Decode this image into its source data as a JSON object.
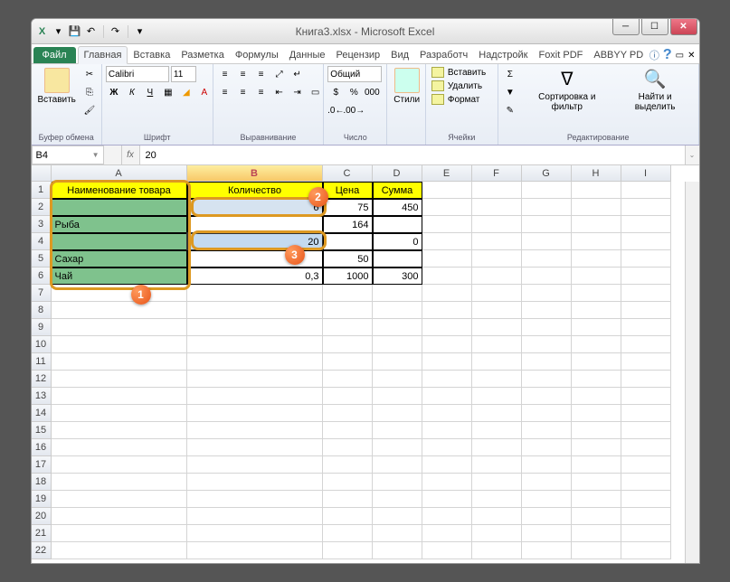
{
  "window": {
    "title": "Книга3.xlsx - Microsoft Excel"
  },
  "qat": {
    "excel_icon": "X",
    "dropdown": "▾"
  },
  "win_controls": {
    "minimize": "─",
    "maximize": "☐",
    "close": "✕"
  },
  "ribbon_tabs": {
    "file": "Файл",
    "items": [
      "Главная",
      "Вставка",
      "Разметка",
      "Формулы",
      "Данные",
      "Рецензир",
      "Вид",
      "Разработч",
      "Надстройк",
      "Foxit PDF",
      "ABBYY PD"
    ],
    "active_index": 0,
    "help_icon": "?",
    "min_icon": "▭"
  },
  "ribbon_groups": {
    "clipboard": {
      "label": "Буфер обмена",
      "paste": "Вставить"
    },
    "font": {
      "label": "Шрифт",
      "name": "Calibri",
      "size": "11"
    },
    "alignment": {
      "label": "Выравнивание"
    },
    "number": {
      "label": "Число",
      "format": "Общий"
    },
    "styles": {
      "label": "",
      "btn": "Стили"
    },
    "cells": {
      "label": "Ячейки",
      "insert": "Вставить",
      "delete": "Удалить",
      "format": "Формат"
    },
    "editing": {
      "label": "Редактирование",
      "sort": "Сортировка и фильтр",
      "find": "Найти и выделить"
    }
  },
  "formula_bar": {
    "name_box": "B4",
    "fx": "fx",
    "value": "20"
  },
  "columns": [
    "A",
    "B",
    "C",
    "D",
    "E",
    "F",
    "G",
    "H",
    "I"
  ],
  "highlighted_col": "B",
  "rows": [
    "1",
    "2",
    "3",
    "4",
    "5",
    "6",
    "7",
    "8",
    "9",
    "10",
    "11",
    "12",
    "13",
    "14",
    "15",
    "16",
    "17",
    "18",
    "19",
    "20",
    "21",
    "22"
  ],
  "table": {
    "headers": [
      "Наименование товара",
      "Количество",
      "Цена",
      "Сумма"
    ],
    "data": [
      {
        "a": "",
        "b": "6",
        "c": "75",
        "d": "450"
      },
      {
        "a": "Рыба",
        "b": "",
        "c": "164",
        "d": ""
      },
      {
        "a": "",
        "b": "20",
        "c": "",
        "d": "0"
      },
      {
        "a": "Сахар",
        "b": "",
        "c": "50",
        "d": ""
      },
      {
        "a": "Чай",
        "b": "0,3",
        "c": "1000",
        "d": "300"
      }
    ]
  },
  "annotations": {
    "b1": "1",
    "b2": "2",
    "b3": "3"
  }
}
